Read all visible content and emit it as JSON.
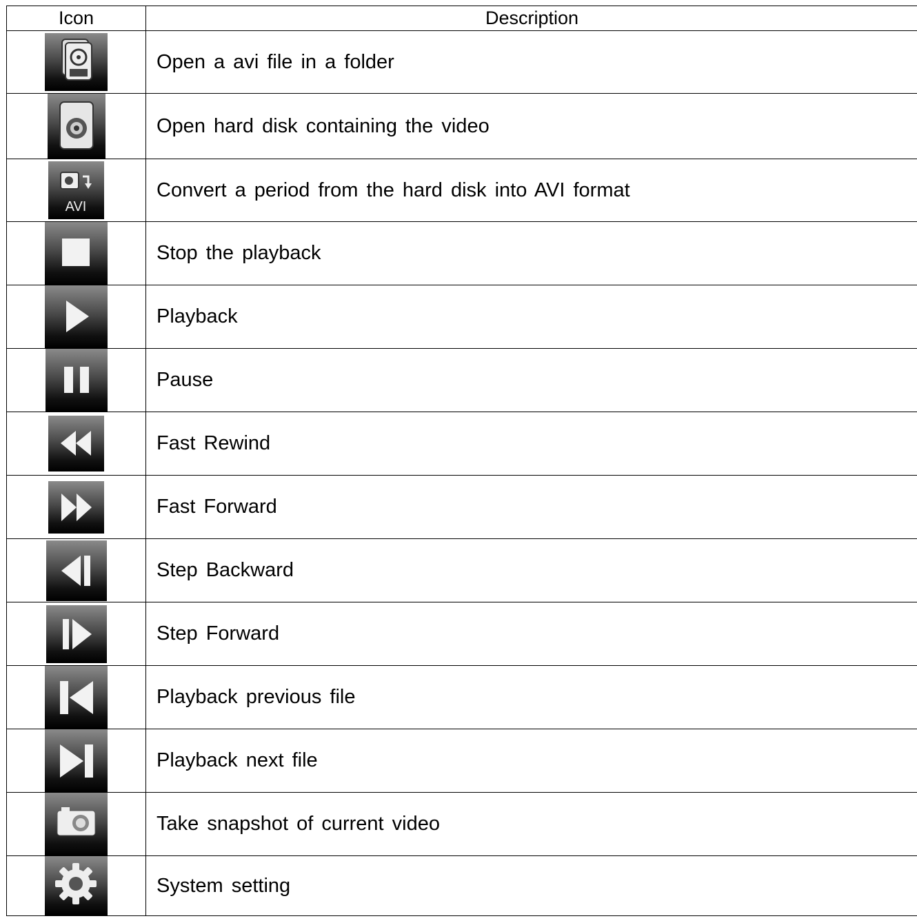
{
  "table": {
    "headers": {
      "icon": "Icon",
      "description": "Description"
    },
    "rows": [
      {
        "icon": "avi-file-icon",
        "description": "Open a avi file in a folder"
      },
      {
        "icon": "hard-disk-icon",
        "description": "Open hard disk containing the video"
      },
      {
        "icon": "convert-avi-icon",
        "icon_text": "AVI",
        "description": "Convert a period from the hard disk into AVI format"
      },
      {
        "icon": "stop-icon",
        "description": "Stop  the  playback"
      },
      {
        "icon": "play-icon",
        "description": "Playback"
      },
      {
        "icon": "pause-icon",
        "description": "Pause"
      },
      {
        "icon": "fast-rewind-icon",
        "description": "Fast  Rewind"
      },
      {
        "icon": "fast-forward-icon",
        "description": "Fast  Forward"
      },
      {
        "icon": "step-backward-icon",
        "description": "Step  Backward"
      },
      {
        "icon": "step-forward-icon",
        "description": "Step  Forward"
      },
      {
        "icon": "previous-file-icon",
        "description": "Playback  previous  file"
      },
      {
        "icon": "next-file-icon",
        "description": "Playback  next  file"
      },
      {
        "icon": "snapshot-icon",
        "description": "Take  snapshot  of  current  video"
      },
      {
        "icon": "settings-gear-icon",
        "description": "System  setting"
      }
    ]
  }
}
